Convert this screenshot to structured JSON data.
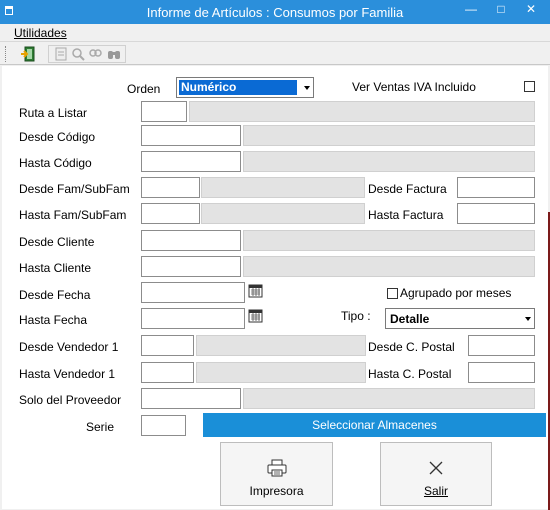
{
  "window": {
    "title": "Informe de Artículos : Consumos por Familia"
  },
  "menu": {
    "utilidades": "Utilidades"
  },
  "form": {
    "orden_label": "Orden",
    "orden_value": "Numérico",
    "ver_ventas_label": "Ver Ventas IVA Incluido",
    "ruta_label": "Ruta a Listar",
    "desde_codigo_label": "Desde Código",
    "hasta_codigo_label": "Hasta Código",
    "desde_fam_label": "Desde Fam/SubFam",
    "hasta_fam_label": "Hasta Fam/SubFam",
    "desde_factura_label": "Desde Factura",
    "hasta_factura_label": "Hasta Factura",
    "desde_cliente_label": "Desde Cliente",
    "hasta_cliente_label": "Hasta Cliente",
    "desde_fecha_label": "Desde Fecha",
    "hasta_fecha_label": "Hasta Fecha",
    "agrupado_label": "Agrupado por meses",
    "tipo_label": "Tipo :",
    "tipo_value": "Detalle",
    "desde_vendedor_label": "Desde Vendedor 1",
    "hasta_vendedor_label": "Hasta Vendedor 1",
    "desde_cpostal_label": "Desde C. Postal",
    "hasta_cpostal_label": "Hasta C. Postal",
    "proveedor_label": "Solo del Proveedor",
    "serie_label": "Serie"
  },
  "buttons": {
    "seleccionar_almacenes": "Seleccionar Almacenes",
    "impresora": "Impresora",
    "salir": "Salir"
  }
}
